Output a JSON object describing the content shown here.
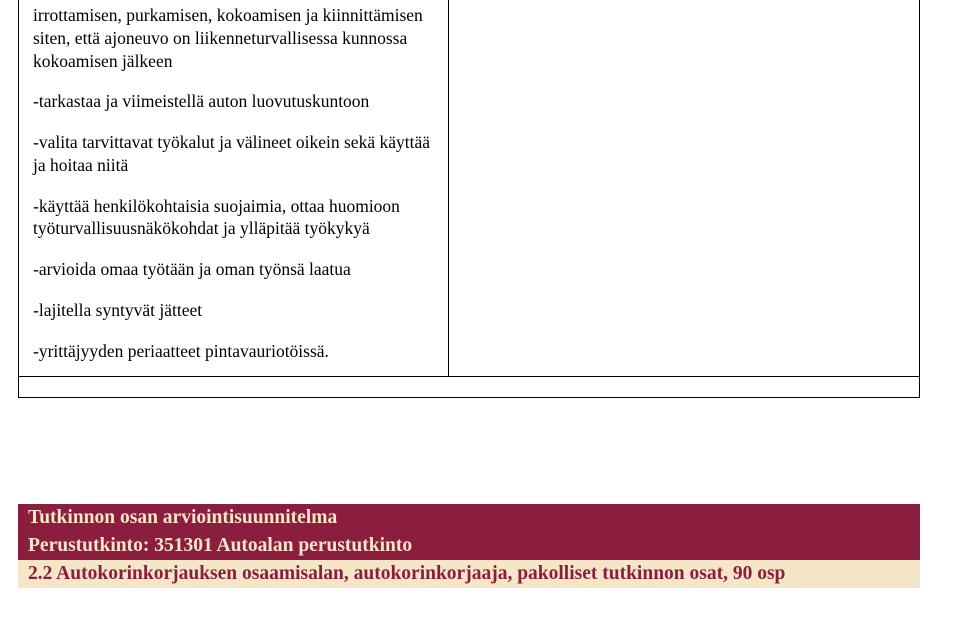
{
  "content": {
    "p1": "irrottamisen, purkamisen, kokoamisen ja kiinnittämisen siten, että ajoneuvo on liikenneturvallisessa kunnossa kokoamisen jälkeen",
    "p2": "-tarkastaa ja viimeistellä auton luovutuskuntoon",
    "p3": "-valita tarvittavat työkalut ja välineet oikein sekä käyttää ja hoitaa niitä",
    "p4": "-käyttää henkilökohtaisia suojaimia, ottaa huomioon työturvallisuusnäkökohdat ja ylläpitää työkykyä",
    "p5": "-arvioida omaa työtään ja oman työnsä laatua",
    "p6": "-lajitella syntyvät jätteet",
    "p7": "-yrittäjyyden periaatteet pintavauriotöissä."
  },
  "footer": {
    "line1": "Tutkinnon osan arviointisuunnitelma",
    "line2": "Perustutkinto: 351301 Autoalan perustutkinto",
    "line3": "2.2 Autokorinkorjauksen osaamisalan, autokorinkorjaaja, pakolliset tutkinnon osat, 90 osp"
  }
}
